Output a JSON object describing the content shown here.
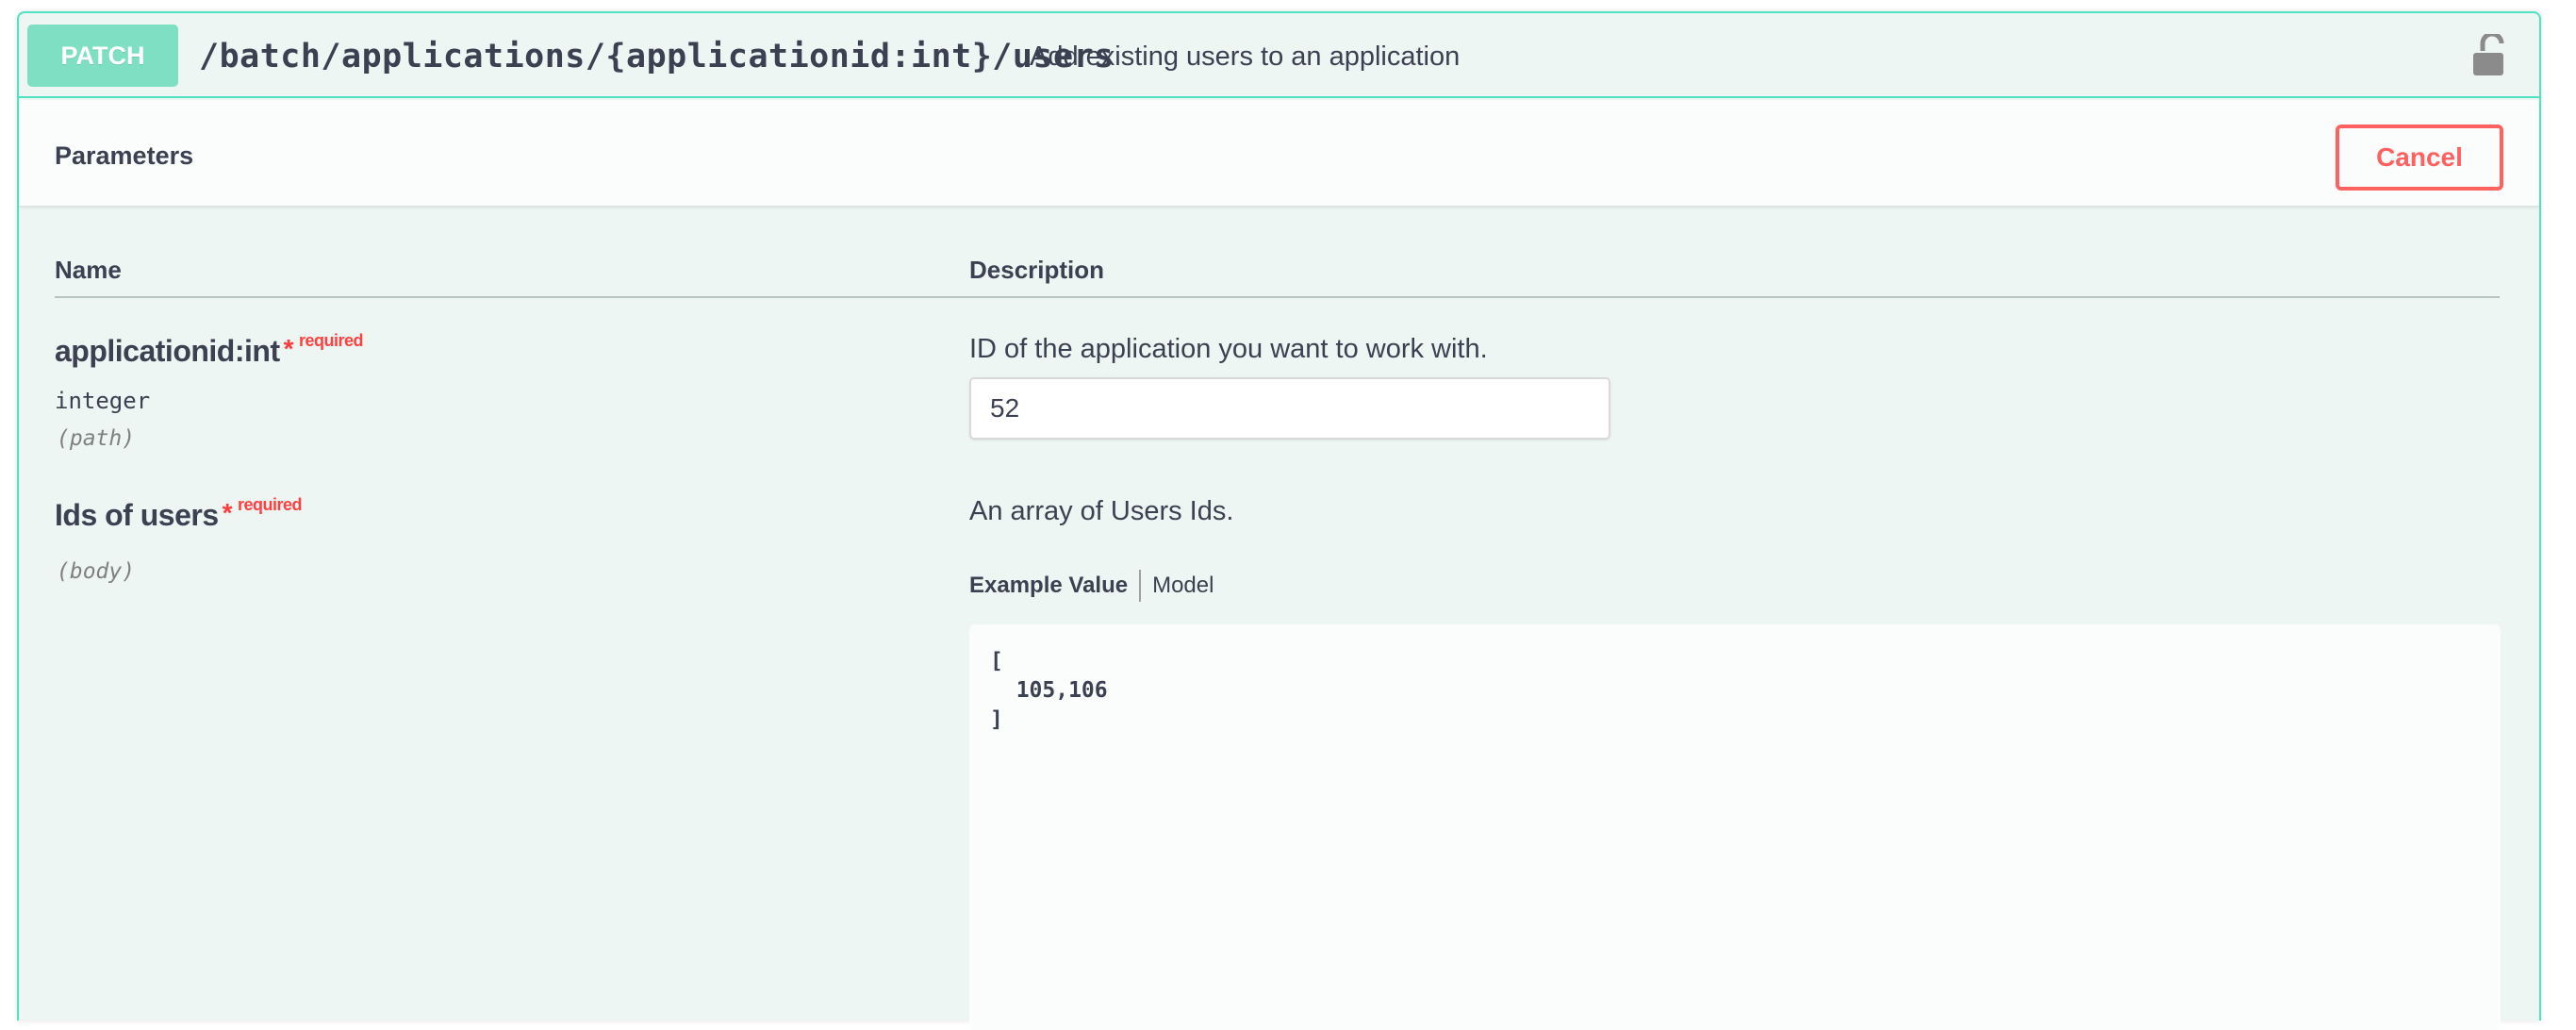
{
  "operation": {
    "method": "PATCH",
    "path": "/batch/applications/{applicationid:int}/users",
    "summary": "Add existing users to an application",
    "lock_icon": "unlocked-lock-icon"
  },
  "parameters_section": {
    "title": "Parameters",
    "cancel_label": "Cancel"
  },
  "table_header": {
    "name": "Name",
    "description": "Description"
  },
  "params": [
    {
      "name": "applicationid:int",
      "required_star": "*",
      "required_label": "required",
      "type": "integer",
      "in": "(path)",
      "description": "ID of the application you want to work with.",
      "value": "52"
    },
    {
      "name": "Ids of users",
      "required_star": "*",
      "required_label": "required",
      "in": "(body)",
      "description": "An array of Users Ids.",
      "tabs": {
        "example_value": "Example Value",
        "model": "Model"
      },
      "example_body": "[\n  105,106\n]"
    }
  ],
  "colors": {
    "accent": "#50e3c2",
    "method_bg": "#7fdfc3",
    "block_bg": "#edf6f2",
    "cancel": "#ff6060",
    "required": "#ff4040"
  }
}
